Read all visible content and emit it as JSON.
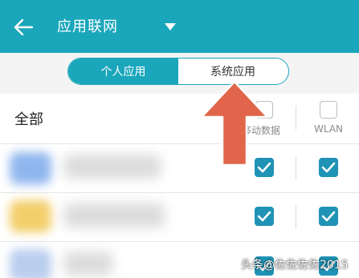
{
  "header": {
    "title": "应用联网",
    "back_icon": "back-arrow-icon",
    "dropdown_icon": "dropdown-triangle-icon",
    "accent_color": "#1aa6bb"
  },
  "segment": {
    "tabs": [
      {
        "label": "个人应用",
        "active": true
      },
      {
        "label": "系统应用",
        "active": false
      }
    ]
  },
  "list_header": {
    "all_label": "全部",
    "columns": [
      {
        "label": "移动数据",
        "checked": false
      },
      {
        "label": "WLAN",
        "checked": false
      }
    ]
  },
  "app_rows": [
    {
      "mobile_data": true,
      "wlan": true
    },
    {
      "mobile_data": true,
      "wlan": true
    },
    {
      "mobile_data": true,
      "wlan": true
    }
  ],
  "overlay": {
    "arrow_color": "#e0654a",
    "watermark": "头条@佐佐佐佐2015"
  }
}
